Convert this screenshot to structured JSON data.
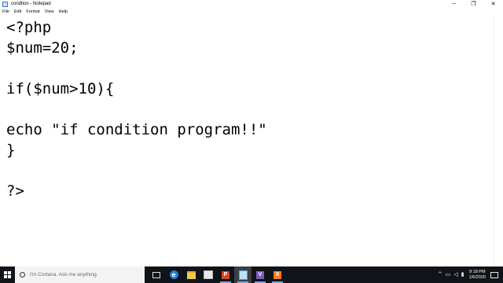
{
  "window": {
    "title": "condtion - Notepad",
    "controls": {
      "minimize": "─",
      "restore": "❐",
      "close": "✕"
    }
  },
  "menu": [
    "File",
    "Edit",
    "Format",
    "View",
    "Help"
  ],
  "editor": {
    "lines": [
      "<?php",
      "$num=20;",
      "",
      "if($num>10){",
      "",
      "echo \"if condition program!!\"",
      "}",
      "",
      "?>"
    ]
  },
  "taskbar": {
    "search_placeholder": "I'm Cortana. Ask me anything.",
    "apps": [
      {
        "icon": "task-view-icon"
      },
      {
        "icon": "edge-icon",
        "glyph": "e"
      },
      {
        "icon": "file-explorer-icon"
      },
      {
        "icon": "store-icon"
      },
      {
        "icon": "powerpoint-icon",
        "glyph": "P"
      },
      {
        "icon": "notepad-icon"
      },
      {
        "icon": "visual-studio-icon",
        "glyph": "V"
      },
      {
        "icon": "xampp-icon",
        "glyph": "X"
      }
    ],
    "tray": {
      "chevron": "^",
      "time": "9:18 PM",
      "date": "1/6/2020"
    }
  }
}
